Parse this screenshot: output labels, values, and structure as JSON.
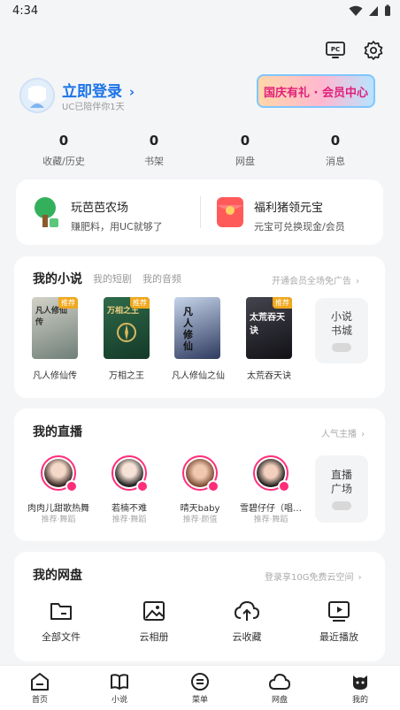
{
  "status": {
    "time": "4:34"
  },
  "header": {
    "pc_icon": "pc-icon",
    "settings_icon": "gear-icon",
    "pc_text": "PC"
  },
  "user": {
    "login_label": "立即登录",
    "subtitle": "UC已陪伴你1天",
    "vip_banner": "国庆有礼 · 会员中心"
  },
  "stats": [
    {
      "value": "0",
      "label": "收藏/历史"
    },
    {
      "value": "0",
      "label": "书架"
    },
    {
      "value": "0",
      "label": "网盘"
    },
    {
      "value": "0",
      "label": "消息"
    }
  ],
  "promos": [
    {
      "title": "玩芭芭农场",
      "subtitle": "赚肥料，用UC就够了",
      "icon": "tree-icon"
    },
    {
      "title": "福利猪领元宝",
      "subtitle": "元宝可兑换现金/会员",
      "icon": "red-envelope-icon"
    }
  ],
  "novel": {
    "title": "我的小说",
    "tabs": [
      "我的短剧",
      "我的音频"
    ],
    "link": "开通会员全场免广告",
    "books": [
      {
        "title": "凡人修仙传",
        "tag": "推荐",
        "colors": [
          "#c9c9c1",
          "#6f7f78"
        ]
      },
      {
        "title": "万相之王",
        "tag": "推荐",
        "colors": [
          "#2f6a4a",
          "#143a28"
        ]
      },
      {
        "title": "凡人修仙之仙",
        "tag": "",
        "colors": [
          "#8aa0c8",
          "#2e3a5f"
        ]
      },
      {
        "title": "太荒吞天诀",
        "tag": "推荐",
        "colors": [
          "#3a3a44",
          "#111116"
        ]
      }
    ],
    "cover_texts": [
      "凡人修仙传",
      "万相之王",
      "凡人修仙",
      "太荒吞天诀"
    ],
    "side_box": [
      "小说",
      "书城"
    ]
  },
  "live": {
    "title": "我的直播",
    "link": "人气主播",
    "streamers": [
      {
        "name": "肉肉儿甜歌热舞",
        "sub": "推荐·舞蹈"
      },
      {
        "name": "若楠不难",
        "sub": "推荐·舞蹈"
      },
      {
        "name": "晴天baby",
        "sub": "推荐·颜值"
      },
      {
        "name": "雪碧仔仔（唱…",
        "sub": "推荐·舞蹈"
      }
    ],
    "side_box": [
      "直播",
      "广场"
    ]
  },
  "disk": {
    "title": "我的网盘",
    "link": "登录享10G免费云空间",
    "items": [
      {
        "label": "全部文件",
        "icon": "folder-icon"
      },
      {
        "label": "云相册",
        "icon": "photo-album-icon"
      },
      {
        "label": "云收藏",
        "icon": "cloud-upload-icon"
      },
      {
        "label": "最近播放",
        "icon": "recent-play-icon"
      }
    ]
  },
  "nav": [
    {
      "label": "首页",
      "icon": "home-icon"
    },
    {
      "label": "小说",
      "icon": "book-icon"
    },
    {
      "label": "菜单",
      "icon": "menu-icon"
    },
    {
      "label": "网盘",
      "icon": "cloud-icon"
    },
    {
      "label": "我的",
      "icon": "profile-icon"
    }
  ],
  "colors": {
    "accent": "#1a73e8",
    "live": "#ff2d7a",
    "tag": "#f0a81e"
  }
}
